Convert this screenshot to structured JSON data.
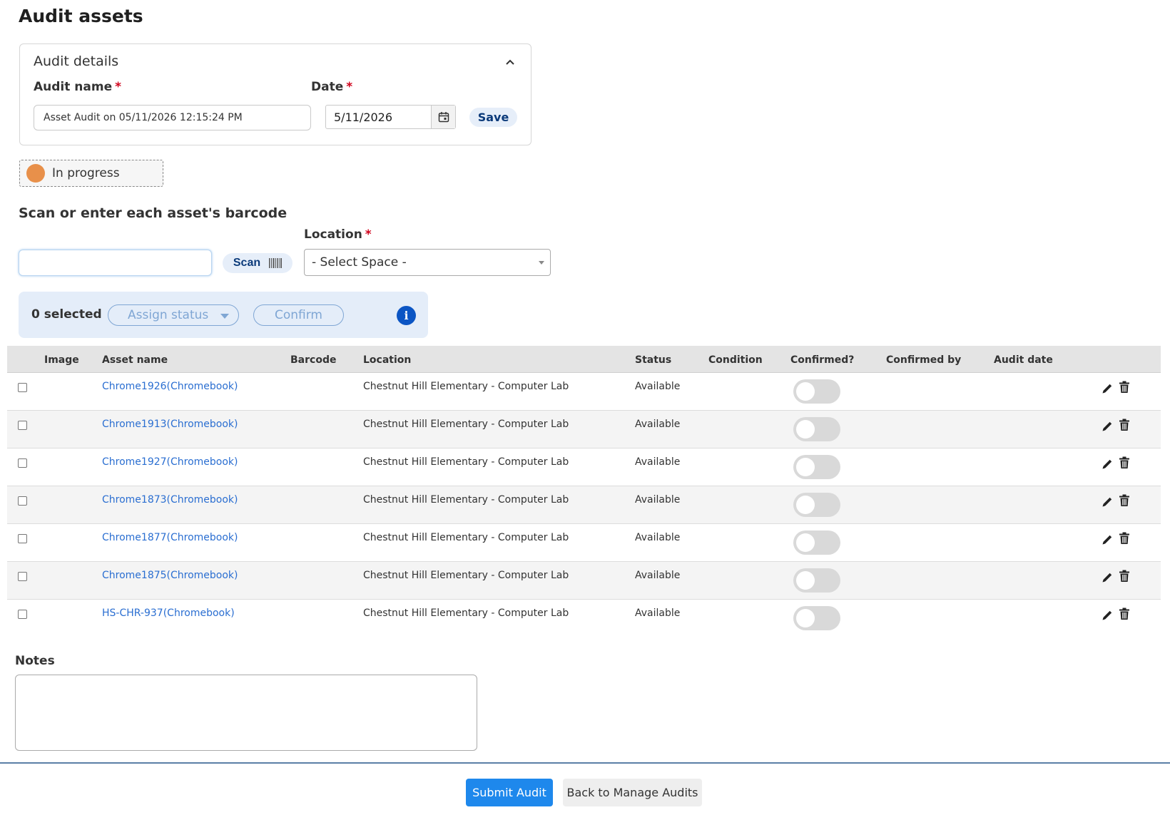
{
  "page": {
    "title": "Audit assets"
  },
  "details": {
    "title": "Audit details",
    "audit_name_label": "Audit name",
    "audit_name_value": "Asset Audit on 05/11/2026 12:15:24 PM",
    "date_label": "Date",
    "date_value": "5/11/2026",
    "required_marker": "*",
    "save_label": "Save"
  },
  "status": {
    "label": "In progress",
    "color": "#e8904a"
  },
  "scan": {
    "heading": "Scan or enter each asset's barcode",
    "barcode_value": "",
    "scan_label": "Scan",
    "location_label": "Location",
    "location_value": "- Select Space -"
  },
  "bulk": {
    "selected_text": "0 selected",
    "assign_status_label": "Assign status",
    "confirm_label": "Confirm",
    "info_glyph": "i"
  },
  "table": {
    "columns": [
      "Image",
      "Asset name",
      "Barcode",
      "Location",
      "Status",
      "Condition",
      "Confirmed?",
      "Confirmed by",
      "Audit date"
    ],
    "rows": [
      {
        "asset": "Chrome1926(Chromebook)",
        "barcode": "",
        "location": "Chestnut Hill Elementary - Computer Lab",
        "status": "Available",
        "condition": "",
        "confirmed": false,
        "confirmed_by": "",
        "audit_date": ""
      },
      {
        "asset": "Chrome1913(Chromebook)",
        "barcode": "",
        "location": "Chestnut Hill Elementary - Computer Lab",
        "status": "Available",
        "condition": "",
        "confirmed": false,
        "confirmed_by": "",
        "audit_date": ""
      },
      {
        "asset": "Chrome1927(Chromebook)",
        "barcode": "",
        "location": "Chestnut Hill Elementary - Computer Lab",
        "status": "Available",
        "condition": "",
        "confirmed": false,
        "confirmed_by": "",
        "audit_date": ""
      },
      {
        "asset": "Chrome1873(Chromebook)",
        "barcode": "",
        "location": "Chestnut Hill Elementary - Computer Lab",
        "status": "Available",
        "condition": "",
        "confirmed": false,
        "confirmed_by": "",
        "audit_date": ""
      },
      {
        "asset": "Chrome1877(Chromebook)",
        "barcode": "",
        "location": "Chestnut Hill Elementary - Computer Lab",
        "status": "Available",
        "condition": "",
        "confirmed": false,
        "confirmed_by": "",
        "audit_date": ""
      },
      {
        "asset": "Chrome1875(Chromebook)",
        "barcode": "",
        "location": "Chestnut Hill Elementary - Computer Lab",
        "status": "Available",
        "condition": "",
        "confirmed": false,
        "confirmed_by": "",
        "audit_date": ""
      },
      {
        "asset": "HS-CHR-937(Chromebook)",
        "barcode": "",
        "location": "Chestnut Hill Elementary - Computer Lab",
        "status": "Available",
        "condition": "",
        "confirmed": false,
        "confirmed_by": "",
        "audit_date": ""
      }
    ]
  },
  "notes": {
    "label": "Notes",
    "value": ""
  },
  "footer": {
    "submit_label": "Submit Audit",
    "back_label": "Back to Manage Audits"
  },
  "icons": {
    "collapse": "chevron-up-icon",
    "calendar": "calendar-icon",
    "barcode": "barcode-icon",
    "dropdown": "caret-down-icon",
    "info": "info-icon",
    "edit": "pencil-icon",
    "delete": "trash-icon"
  },
  "colors": {
    "accent": "#1e88ec",
    "link": "#2a6ed1",
    "required": "#d0021b",
    "info": "#0b55c4",
    "pill_bg": "#e6eef9"
  }
}
